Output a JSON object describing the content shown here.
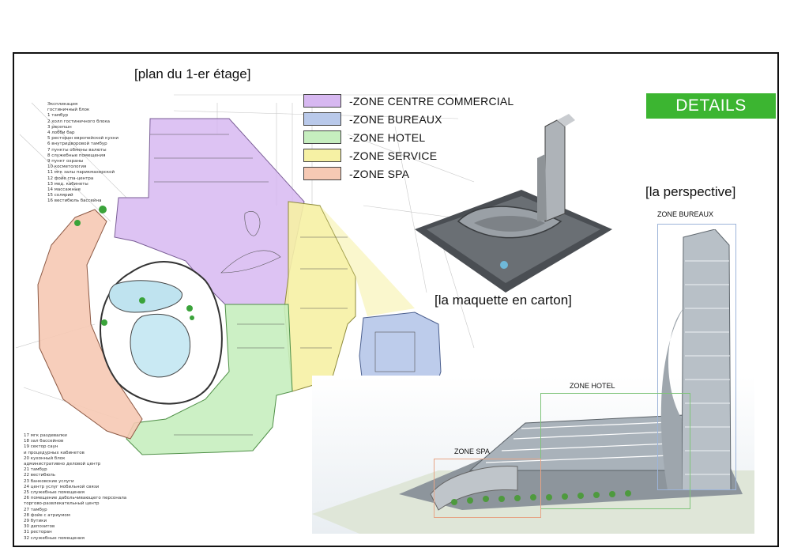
{
  "plan_title": "[plan du 1-er étage]",
  "legend": [
    {
      "label": "-ZONE CENTRE COMMERCIAL",
      "color": "#d7b8f1"
    },
    {
      "label": "-ZONE BUREAUX",
      "color": "#b9c9ea"
    },
    {
      "label": "-ZONE HOTEL",
      "color": "#c6eebf"
    },
    {
      "label": "-ZONE SERVICE",
      "color": "#f6f1a4"
    },
    {
      "label": "-ZONE SPA",
      "color": "#f6c9b4"
    }
  ],
  "details_label": "DETAILS",
  "perspective_label": "[la perspective]",
  "maquette_label": "[la maquette en carton]",
  "zone_labels": {
    "bureaux": "ZONE BUREAUX",
    "hotel": "ZONE HOTEL",
    "spa": "ZONE SPA"
  },
  "notes_top": [
    "Экспликация",
    "гостиничный блок",
    "1 тамбур",
    "2 холл гостиничного блока",
    "3 ресепшн",
    "4 лобби бар",
    "5 ресторан европейской кухни",
    "6 внутридворовой тамбур",
    "7 пункты обмены валюты",
    "8 служебные помещения",
    "9 пункт охраны",
    "10 косметология",
    "11 мгк залы парикмахерской",
    "12 фойе спа-центра",
    "13 мед. кабинеты",
    "14 массажные",
    "15 солярий",
    "16 вестибюль бассейна"
  ],
  "notes_bottom": [
    "17 мгк раздевалки",
    "18 зал бассейнов",
    "19 сектор саун",
    "и процедурных кабинетов",
    "20 кухонный блок",
    "административно деловой центр",
    "21 тамбур",
    "22 вестибюль",
    "23 банковские услуги",
    "24 центр услуг мобильной связи",
    "25 служебные помещения",
    "26 помещение дабольчивающего персонала",
    "торгово-развлекательный центр",
    "27 тамбур",
    "28 фойе с атриумом",
    "29 бутики",
    "30 депозитов",
    "31 ресторан",
    "32 служебные помещения"
  ]
}
